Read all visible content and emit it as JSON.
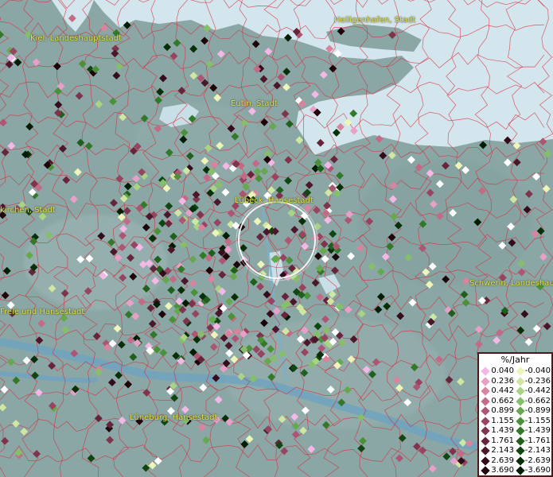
{
  "map": {
    "unit": "%/Jahr",
    "colors": {
      "sea": "#d4e6ed",
      "land": "#8aa7a6",
      "boundary": "#d8283a",
      "label": "#e8e24a",
      "selection_ring": "#ffffff"
    },
    "places": [
      {
        "id": "kiel",
        "label": "Kiel, Landeshauptstadt"
      },
      {
        "id": "heiligenhafen",
        "label": "Heiligenhafen, Stadt"
      },
      {
        "id": "eutin",
        "label": "Eutin, Stadt"
      },
      {
        "id": "luebeck",
        "label": "Lübeck, Hansestadt"
      },
      {
        "id": "neumuenster",
        "label": "kirchen, Stadt"
      },
      {
        "id": "schwerin",
        "label": "Schwerin, Landeshaup"
      },
      {
        "id": "hamburg",
        "label": "Freie und Hansestadt"
      },
      {
        "id": "lueneburg",
        "label": "Lüneburg, Hansestadt"
      }
    ]
  },
  "legend": {
    "title": "%/Jahr",
    "positive": [
      {
        "value": "0.040",
        "color": "#f5b8e6"
      },
      {
        "value": "0.236",
        "color": "#e9a0c8"
      },
      {
        "value": "0.442",
        "color": "#d9849f"
      },
      {
        "value": "0.662",
        "color": "#c36a86"
      },
      {
        "value": "0.899",
        "color": "#ad5572"
      },
      {
        "value": "1.155",
        "color": "#974460"
      },
      {
        "value": "1.439",
        "color": "#7e344c"
      },
      {
        "value": "1.761",
        "color": "#65253a"
      },
      {
        "value": "2.143",
        "color": "#4b172a"
      },
      {
        "value": "2.639",
        "color": "#350c1b"
      },
      {
        "value": "3.690",
        "color": "#1e0409"
      }
    ],
    "negative": [
      {
        "value": "-0.040",
        "color": "#eef5b8"
      },
      {
        "value": "-0.236",
        "color": "#cfe7a0"
      },
      {
        "value": "-0.442",
        "color": "#a9d486"
      },
      {
        "value": "-0.662",
        "color": "#86bf69"
      },
      {
        "value": "-0.899",
        "color": "#66a850"
      },
      {
        "value": "-1.155",
        "color": "#4a913a"
      },
      {
        "value": "-1.439",
        "color": "#34782a"
      },
      {
        "value": "-1.761",
        "color": "#215f1c"
      },
      {
        "value": "-2.143",
        "color": "#124611"
      },
      {
        "value": "-2.639",
        "color": "#073008"
      },
      {
        "value": "-3.690",
        "color": "#001d02"
      }
    ]
  }
}
